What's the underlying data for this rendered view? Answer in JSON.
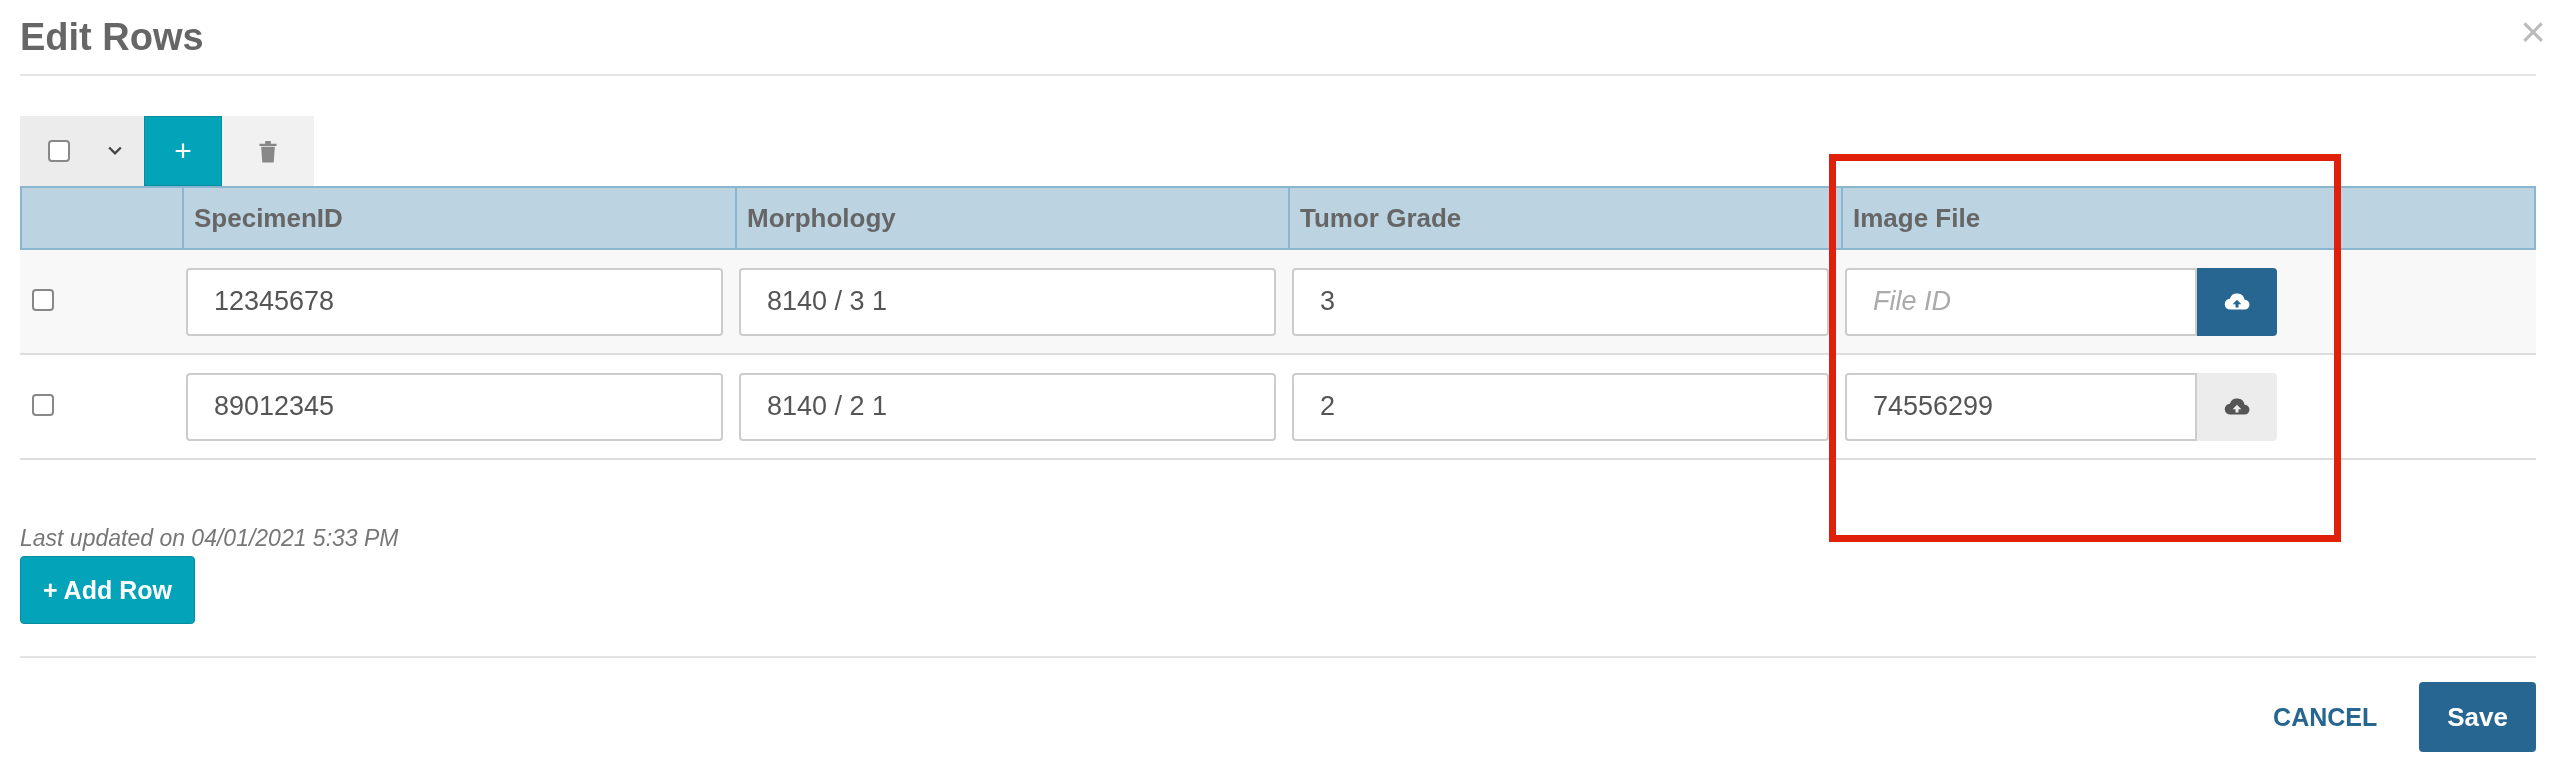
{
  "dialog": {
    "title": "Edit Rows",
    "close": "×"
  },
  "toolbar": {
    "select_all_checked": false,
    "add": "+"
  },
  "table": {
    "columns": [
      {
        "label": "SpecimenID",
        "highlighted": false
      },
      {
        "label": "Morphology",
        "highlighted": false
      },
      {
        "label": "Tumor Grade",
        "highlighted": false
      },
      {
        "label": "Image File",
        "highlighted": true
      }
    ],
    "rows": [
      {
        "checked": false,
        "specimen_id": "12345678",
        "morphology": "8140 / 3 1",
        "tumor_grade": "3",
        "image_file": {
          "placeholder": "File ID",
          "upload_active": true
        }
      },
      {
        "checked": false,
        "specimen_id": "89012345",
        "morphology": "8140 / 2 1",
        "tumor_grade": "2",
        "image_file": {
          "value": "74556299",
          "upload_active": false
        }
      }
    ]
  },
  "last_updated": "Last updated on 04/01/2021 5:33 PM",
  "add_row": "+ Add Row",
  "footer": {
    "cancel": "CANCEL",
    "save": "Save"
  }
}
